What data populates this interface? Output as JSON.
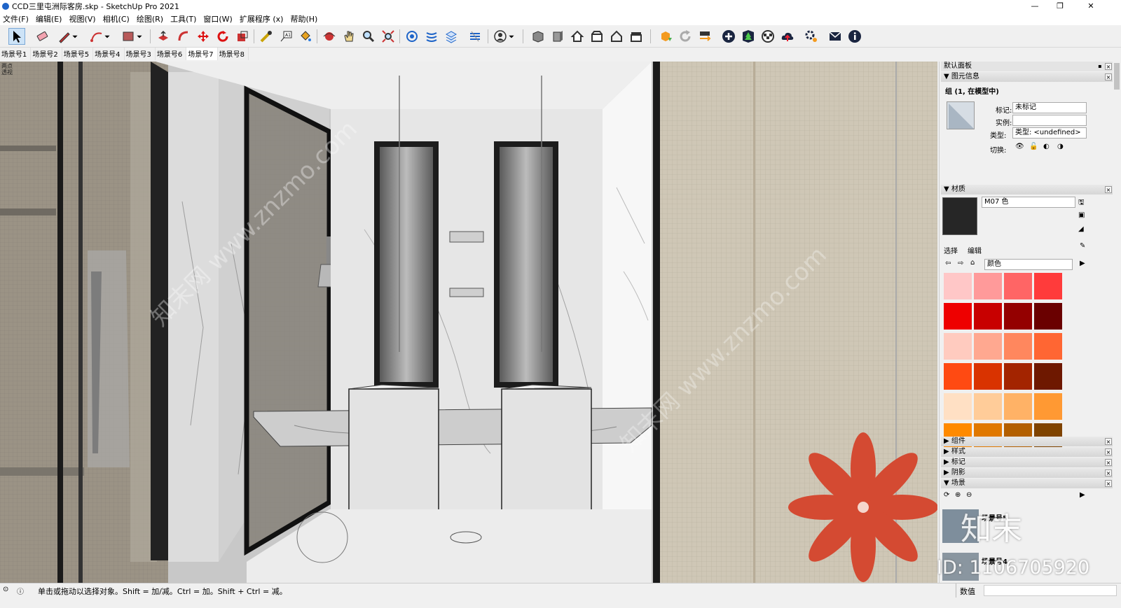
{
  "window": {
    "title": "CCD三里屯洲际客房.skp - SketchUp Pro 2021",
    "minimize": "—",
    "maximize": "❐",
    "close": "✕"
  },
  "menu": [
    "文件(F)",
    "编辑(E)",
    "视图(V)",
    "相机(C)",
    "绘图(R)",
    "工具(T)",
    "窗口(W)",
    "扩展程序 (x)",
    "帮助(H)"
  ],
  "toolbar": {
    "icons": [
      "select-arrow-icon",
      "eraser-icon",
      "pencil-line-icon",
      "dropdown-arrow-icon",
      "arc-icon",
      "dropdown-arrow-icon",
      "rectangle-icon",
      "dropdown-arrow-icon",
      "push-pull-icon",
      "follow-me-icon",
      "move-icon",
      "rotate-icon",
      "scale-icon",
      "tape-measure-icon",
      "text-label-icon",
      "paint-bucket-icon",
      "orbit-icon",
      "pan-icon",
      "zoom-icon",
      "zoom-extents-icon",
      "sandbox-icon",
      "stairs-plugin-icon",
      "layers-plugin-icon",
      "terrain-plugin-icon",
      "user-account-icon",
      "dropdown-arrow-icon",
      "components-box-icon",
      "front-view-icon",
      "house-iso-icon",
      "house-top-icon",
      "house-outline-icon",
      "house-back-icon",
      "extension-warehouse-icon",
      "refresh-icon",
      "transfer-icon",
      "add-circle-icon",
      "tree-3d-icon",
      "checker-sphere-icon",
      "cloud-upload-icon",
      "settings-gears-icon",
      "mail-icon",
      "info-icon"
    ]
  },
  "scene_tabs": [
    "场景号1",
    "场景号2",
    "场景号5",
    "场景号4",
    "场景号3",
    "场景号6",
    "场景号7",
    "场景号8"
  ],
  "active_scene": "场景号7",
  "viewport": {
    "label": "两点透视"
  },
  "tray": {
    "title": "默认面板",
    "entity_info": {
      "header": "图元信息",
      "selection": "组 (1, 在模型中)",
      "tag_label": "标记:",
      "tag_value": "未标记",
      "instance_label": "实例:",
      "instance_value": "",
      "type_label": "类型:",
      "type_value": "类型: <undefined>",
      "toggle_label": "切换:"
    },
    "materials": {
      "header": "材质",
      "name": "M07 色",
      "tab_select": "选择",
      "tab_edit": "编辑",
      "library": "颜色",
      "swatches": [
        "#ffc7c7",
        "#ff9a9a",
        "#ff6565",
        "#ff3b3b",
        "#ee0000",
        "#c80000",
        "#940000",
        "#6a0000",
        "#ffcbbf",
        "#ffa890",
        "#ff875e",
        "#ff6633",
        "#ff4a12",
        "#d93300",
        "#a32400",
        "#6e1800",
        "#ffe0c4",
        "#ffcc99",
        "#ffb266",
        "#ff9933",
        "#ff8a00",
        "#e07800",
        "#b35f00",
        "#7f4300"
      ]
    },
    "collapsed": [
      "组件",
      "样式",
      "标记",
      "阴影"
    ],
    "scenes": {
      "header": "场景",
      "items": [
        "场景号5",
        "场景号4"
      ]
    }
  },
  "status": {
    "hint": "单击或拖动以选择对象。Shift = 加/减。Ctrl = 加。Shift + Ctrl = 减。",
    "measurements_label": "数值"
  },
  "overlay": {
    "site": "知末网 www.znzmo.com",
    "brand": "知末",
    "id": "ID: 1106705920"
  },
  "colors": {
    "brand": "#d44a32",
    "accent_blue": "#1e64c8"
  }
}
